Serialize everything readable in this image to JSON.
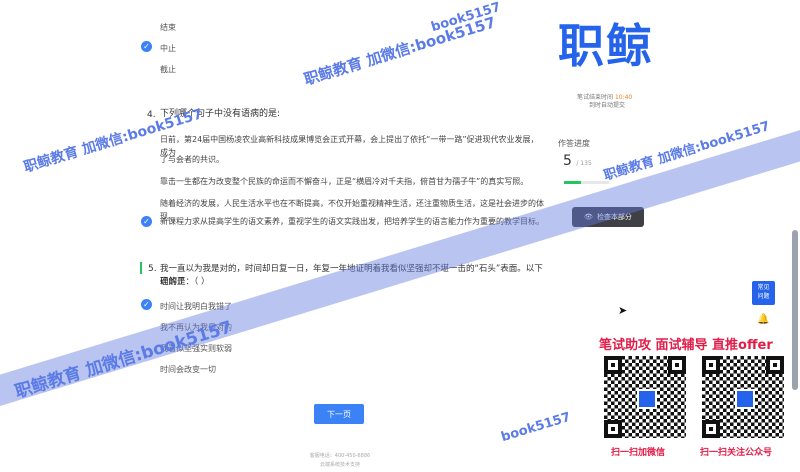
{
  "question4": {
    "options_prev": [
      "结束",
      "中止",
      "截止"
    ],
    "number": "4.",
    "prompt": "下列哪个句子中没有语病的是:",
    "options": [
      "日前，第24届中国杨凌农业高新科技成果博览会正式开幕，会上提出了依托“一带一路”促进现代农业发展，成为",
      "了与会者的共识。",
      "靠击一生都在为改变整个民族的命运而不懈奋斗，正是“横眉冷对千夫指，俯首甘为孺子牛”的真实写照。",
      "随着经济的发展，人民生活水平也在不断提高，不仅开始重视精神生活，还注重物质生活，这是社会进步的体现。",
      "新课程力求从提高学生的语文素养，重视学生的语文实践出发，把培养学生的语言能力作为重要的教学目标。"
    ]
  },
  "question5": {
    "number": "5.",
    "prompt_line1": "我一直以为我是对的，时间却日复一日，年复一年地证明着我看似坚强却不堪一击的“石头”表面。以下理解正",
    "prompt_line2": "确的是：（ ）",
    "options": [
      "时间让我明白我错了",
      "我不再认为我是对的",
      "我看似坚强实则软弱",
      "时间会改变一切"
    ]
  },
  "next_button": "下一页",
  "footer": {
    "phone": "客服电话：400-450-6886",
    "line2": "云端系统技术支持"
  },
  "sidebar": {
    "brand": "职鲸",
    "timer_label": "笔试结束时间",
    "timer_value": "10:40",
    "auto_submit": "到时自动提交",
    "progress_label": "作答进度",
    "progress_done": "5",
    "progress_total": "/ 135",
    "progress_fraction": 0.037,
    "check_section": "检查本部分",
    "fab_line1": "常见",
    "fab_line2": "问题"
  },
  "promo": {
    "headline": "笔试助攻  面试辅导  直推offer",
    "qr1_caption": "扫一扫加微信",
    "qr2_caption": "扫一扫关注公众号"
  },
  "watermarks": [
    "职鲸教育 加微信:book5157",
    "职鲸教育 加微信:book5157",
    "职鲸教育 加微信:book5157",
    "职鲸教育 加微信:book5157",
    "book5157",
    "book5157"
  ],
  "colors": {
    "accent": "#3b82f6",
    "brand": "#2563eb",
    "promo": "#e11d48",
    "progress": "#22c55e"
  }
}
